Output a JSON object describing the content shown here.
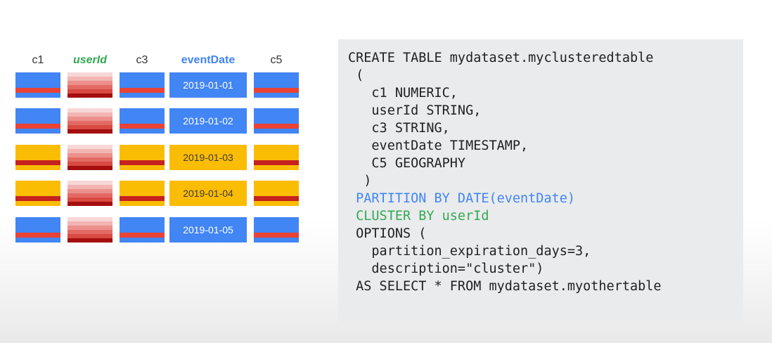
{
  "table": {
    "headers": [
      "c1",
      "userId",
      "c3",
      "eventDate",
      "c5"
    ],
    "dates": [
      "2019-01-01",
      "2019-01-02",
      "2019-01-03",
      "2019-01-04",
      "2019-01-05"
    ]
  },
  "colors": {
    "blue": "#4285f4",
    "yellow": "#fbbc04",
    "red": "#ea4335",
    "dark_red": "#c5221f",
    "green": "#34a853",
    "code_background": "#e9ebec"
  },
  "code": {
    "lines": [
      "CREATE TABLE mydataset.myclusteredtable",
      " (",
      "   c1 NUMERIC,",
      "   userId STRING,",
      "   c3 STRING,",
      "   eventDate TIMESTAMP,",
      "   C5 GEOGRAPHY",
      "  )",
      " PARTITION BY DATE(eventDate)",
      " CLUSTER BY userId",
      " OPTIONS (",
      "   partition_expiration_days=3,",
      "   description=\"cluster\")",
      " AS SELECT * FROM mydataset.myothertable"
    ]
  }
}
